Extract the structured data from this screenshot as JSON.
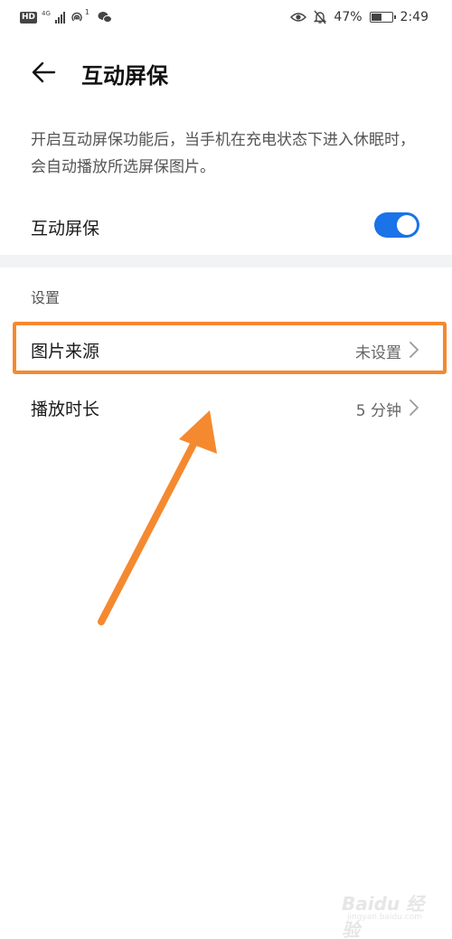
{
  "status_bar": {
    "hd": "HD",
    "network": "4G",
    "hotspot_count": "1",
    "battery_percent": "47%",
    "battery_level": 0.47,
    "time": "2:49",
    "icons": [
      "hd-icon",
      "signal-icon",
      "hotspot-icon",
      "wechat-icon",
      "eye-comfort-icon",
      "mute-bell-icon",
      "battery-icon"
    ]
  },
  "header": {
    "back_icon": "back-arrow-icon",
    "title": "互动屏保"
  },
  "description": "开启互动屏保功能后，当手机在充电状态下进入休眠时，会自动播放所选屏保图片。",
  "toggle": {
    "label": "互动屏保",
    "enabled": true,
    "color": "#1a73e8"
  },
  "settings_section": {
    "header": "设置",
    "items": [
      {
        "label": "图片来源",
        "value": "未设置",
        "icon": "chevron-right-icon"
      },
      {
        "label": "播放时长",
        "value": "5 分钟",
        "icon": "chevron-right-icon"
      }
    ]
  },
  "annotation": {
    "highlight_color": "#f5892f",
    "arrow_color": "#f5892f"
  },
  "watermark": {
    "text": "Baidu 经验",
    "sub": "jingyan.baidu.com"
  }
}
